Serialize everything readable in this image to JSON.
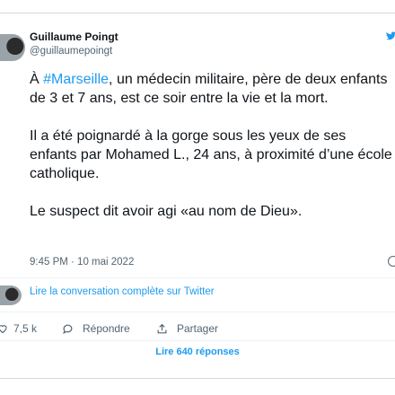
{
  "tweet": {
    "author_name": "Guillaume Poingt",
    "author_handle": "@guillaumepoingt",
    "paragraph1_prefix": "À ",
    "hashtag": "#Marseille",
    "paragraph1_rest": ", un médecin militaire, père de deux enfants de 3 et 7 ans, est ce soir entre la vie et la mort.",
    "paragraph2": "Il a été poignardé à la gorge sous les yeux de ses enfants par Mohamed L., 24 ans, à proximité d’une école catholique.",
    "paragraph3": "Le suspect dit avoir agi «au nom de Dieu».",
    "timestamp": "9:45 PM · 10 mai 2022"
  },
  "conversation": {
    "link_label": "Lire la conversation complète sur Twitter"
  },
  "actions": {
    "likes_count": "7,5 k",
    "reply_label": "Répondre",
    "share_label": "Partager"
  },
  "footer": {
    "read_replies_label": "Lire 640 réponses"
  },
  "colors": {
    "accent": "#1d9bf0",
    "text": "#0f1419",
    "muted": "#536471",
    "border": "#cfd9de"
  }
}
